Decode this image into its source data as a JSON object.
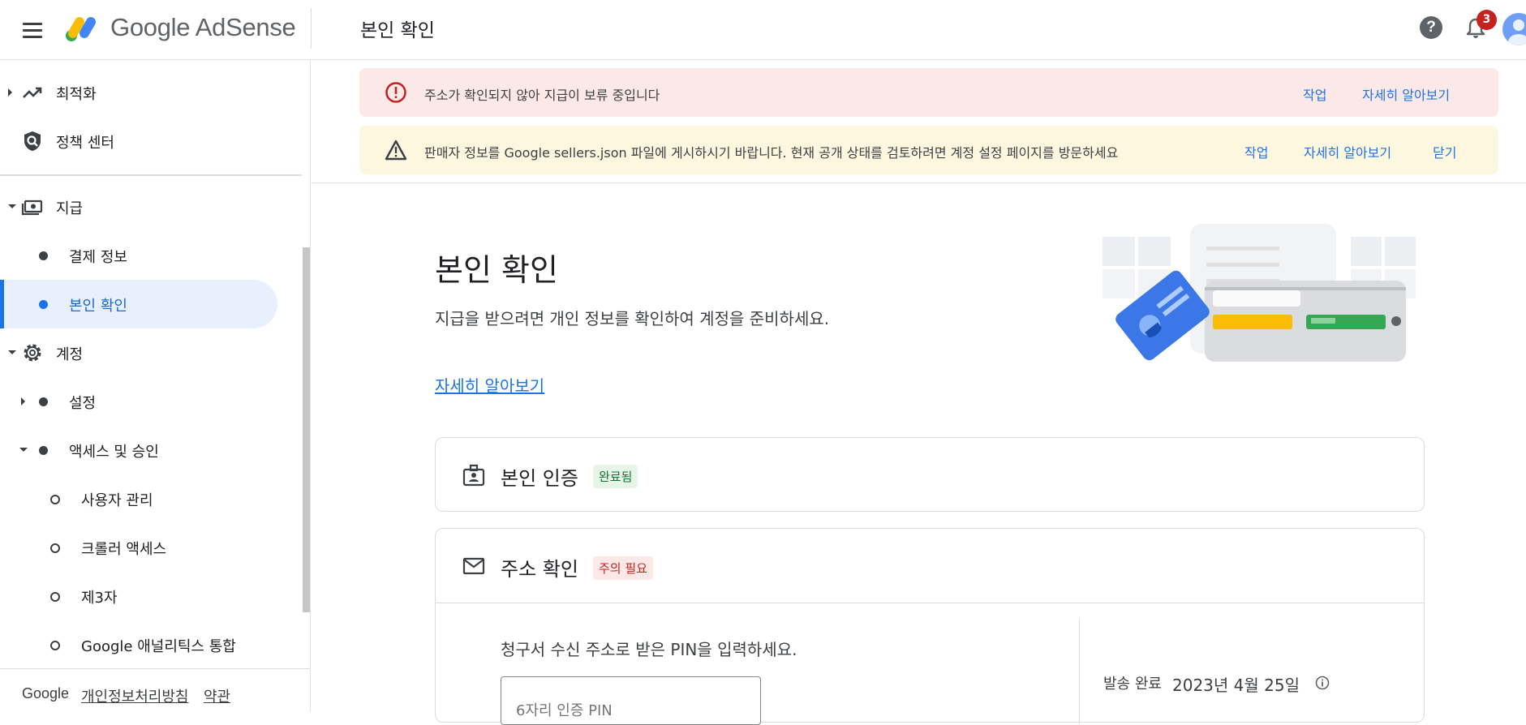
{
  "header": {
    "logo_text": "Google AdSense",
    "page_title": "본인 확인",
    "notification_count": "3",
    "help_glyph": "?"
  },
  "sidebar": {
    "items": [
      {
        "label": "최적화",
        "icon": "trending-up-icon"
      },
      {
        "label": "정책 센터",
        "icon": "policy-shield-icon"
      },
      {
        "label": "지급",
        "icon": "payments-icon"
      },
      {
        "label": "결제 정보"
      },
      {
        "label": "본인 확인"
      },
      {
        "label": "계정",
        "icon": "gear-icon"
      },
      {
        "label": "설정"
      },
      {
        "label": "액세스 및 승인"
      },
      {
        "label": "사용자 관리"
      },
      {
        "label": "크롤러 액세스"
      },
      {
        "label": "제3자"
      },
      {
        "label": "Google 애널리틱스 통합"
      }
    ],
    "footer": {
      "brand": "Google",
      "privacy": "개인정보처리방침",
      "terms": "약관"
    }
  },
  "banners": {
    "error": {
      "message": "주소가 확인되지 않아 지급이 보류 중입니다",
      "action": "작업",
      "learn_more": "자세히 알아보기"
    },
    "warning": {
      "message": "판매자 정보를 Google sellers.json 파일에 게시하시기 바랍니다. 현재 공개 상태를 검토하려면 계정 설정 페이지를 방문하세요",
      "action": "작업",
      "learn_more": "자세히 알아보기",
      "dismiss": "닫기"
    }
  },
  "hero": {
    "title": "본인 확인",
    "description": "지급을 받으려면 개인 정보를 확인하여 계정을 준비하세요.",
    "link": "자세히 알아보기"
  },
  "cards": {
    "identity": {
      "title": "본인 인증",
      "status": "완료됨"
    },
    "address": {
      "title": "주소 확인",
      "status": "주의 필요",
      "pin_prompt": "청구서 수신 주소로 받은 PIN을 입력하세요.",
      "pin_placeholder": "6자리 인증 PIN",
      "sent_label": "발송 완료",
      "sent_date": "2023년 4월 25일"
    }
  },
  "colors": {
    "accent": "#1a73e8",
    "error_bg": "#fce8e6",
    "warning_bg": "#fef7e0",
    "success": "#137333",
    "danger": "#c5221f"
  }
}
